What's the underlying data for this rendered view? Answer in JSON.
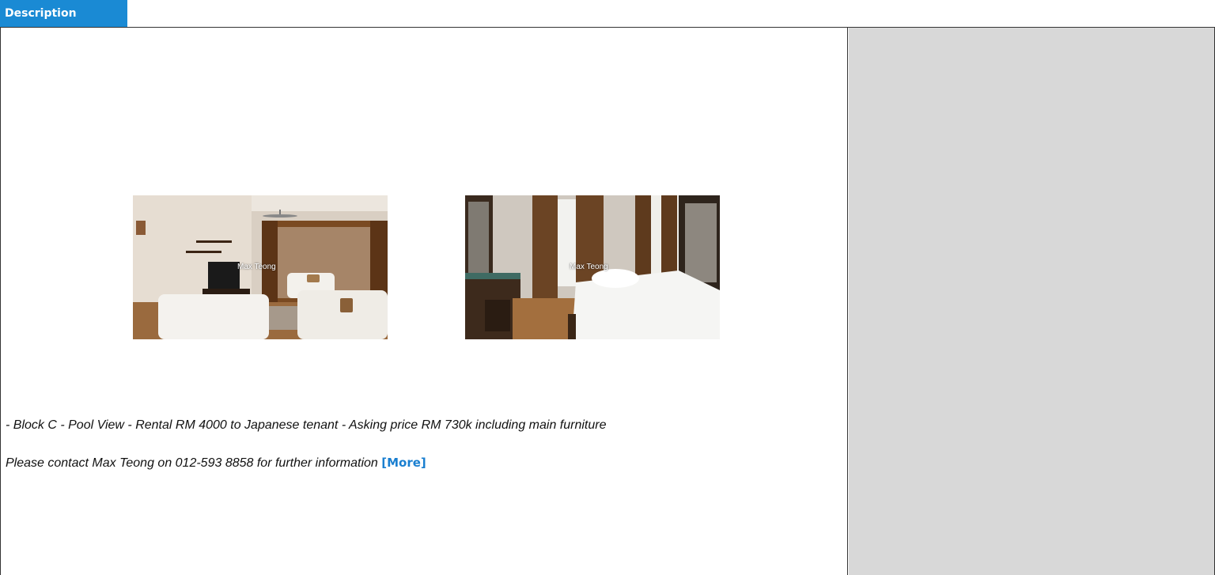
{
  "tab": {
    "label": "Description"
  },
  "photos": [
    {
      "name": "living-room-photo",
      "watermark": "Max Teong"
    },
    {
      "name": "bedroom-photo",
      "watermark": "Max Teong"
    }
  ],
  "description": {
    "line1": "- Block C  - Pool View  - Rental RM 4000 to Japanese tenant  - Asking price RM 730k including main furniture",
    "line2": "Please contact Max Teong on 012-593 8858 for further information",
    "more_label": "[More]"
  },
  "colors": {
    "tab_bg": "#1a8ad4",
    "link": "#1a7fd0",
    "sidebar_bg": "#d8d8d8"
  }
}
